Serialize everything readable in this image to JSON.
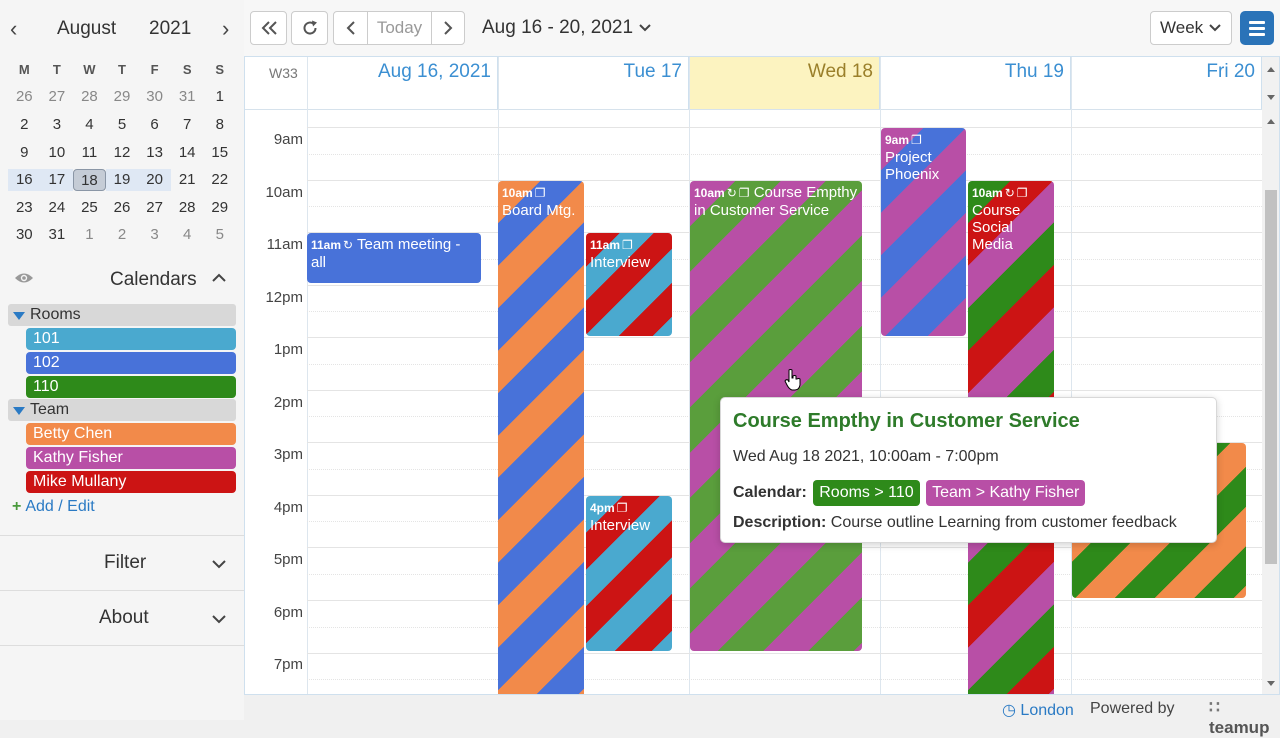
{
  "mini_calendar": {
    "month": "August",
    "year": "2021",
    "weekdays": [
      "M",
      "T",
      "W",
      "T",
      "F",
      "S",
      "S"
    ],
    "weeks": [
      [
        "26",
        "27",
        "28",
        "29",
        "30",
        "31",
        "1"
      ],
      [
        "2",
        "3",
        "4",
        "5",
        "6",
        "7",
        "8"
      ],
      [
        "9",
        "10",
        "11",
        "12",
        "13",
        "14",
        "15"
      ],
      [
        "16",
        "17",
        "18",
        "19",
        "20",
        "21",
        "22"
      ],
      [
        "23",
        "24",
        "25",
        "26",
        "27",
        "28",
        "29"
      ],
      [
        "30",
        "31",
        "1",
        "2",
        "3",
        "4",
        "5"
      ]
    ]
  },
  "calendars": {
    "title": "Calendars",
    "groups": [
      {
        "name": "Rooms",
        "items": [
          {
            "label": "101",
            "color": "#4aa9cf"
          },
          {
            "label": "102",
            "color": "#4872d9"
          },
          {
            "label": "110",
            "color": "#2e8a1a"
          }
        ]
      },
      {
        "name": "Team",
        "items": [
          {
            "label": "Betty Chen",
            "color": "#f28a4a"
          },
          {
            "label": "Kathy Fisher",
            "color": "#b84fa6"
          },
          {
            "label": "Mike Mullany",
            "color": "#cc1414"
          }
        ]
      }
    ],
    "add_edit": "Add / Edit"
  },
  "panels": {
    "filter": "Filter",
    "about": "About"
  },
  "toolbar": {
    "today": "Today",
    "range": "Aug 16 - 20, 2021",
    "view": "Week"
  },
  "grid": {
    "week_label": "W33",
    "days": [
      "Aug 16, 2021",
      "Tue 17",
      "Wed 18",
      "Thu 19",
      "Fri 20"
    ],
    "times": [
      "9am",
      "10am",
      "11am",
      "12pm",
      "1pm",
      "2pm",
      "3pm",
      "4pm",
      "5pm",
      "6pm",
      "7pm"
    ]
  },
  "events": [
    {
      "time": "11am",
      "title": "Team meeting - all"
    },
    {
      "time": "10am",
      "title": "Board Mtg."
    },
    {
      "time": "11am",
      "title": "Interview"
    },
    {
      "time": "4pm",
      "title": "Interview"
    },
    {
      "time": "10am",
      "title": "Course Empthy in Customer Service"
    },
    {
      "time": "9am",
      "title": "Project Phoenix"
    },
    {
      "time": "10am",
      "title": "Course Social Media"
    }
  ],
  "tooltip": {
    "title": "Course Empthy in Customer Service",
    "date": "Wed Aug 18 2021, 10:00am - 7:00pm",
    "calendar_label": "Calendar:",
    "tags": [
      "Rooms > 110",
      "Team > Kathy Fisher"
    ],
    "description_label": "Description:",
    "description": "Course outline Learning from customer feedback"
  },
  "footer": {
    "timezone": "London",
    "powered": "Powered by",
    "brand": "teamup"
  },
  "colors": {
    "accent": "#2a73b8",
    "today_column": "#fcf3c0",
    "room_101": "#4aa9cf",
    "room_102": "#4872d9",
    "room_110": "#2e8a1a",
    "betty": "#f28a4a",
    "kathy": "#b84fa6",
    "mike": "#cc1414"
  }
}
